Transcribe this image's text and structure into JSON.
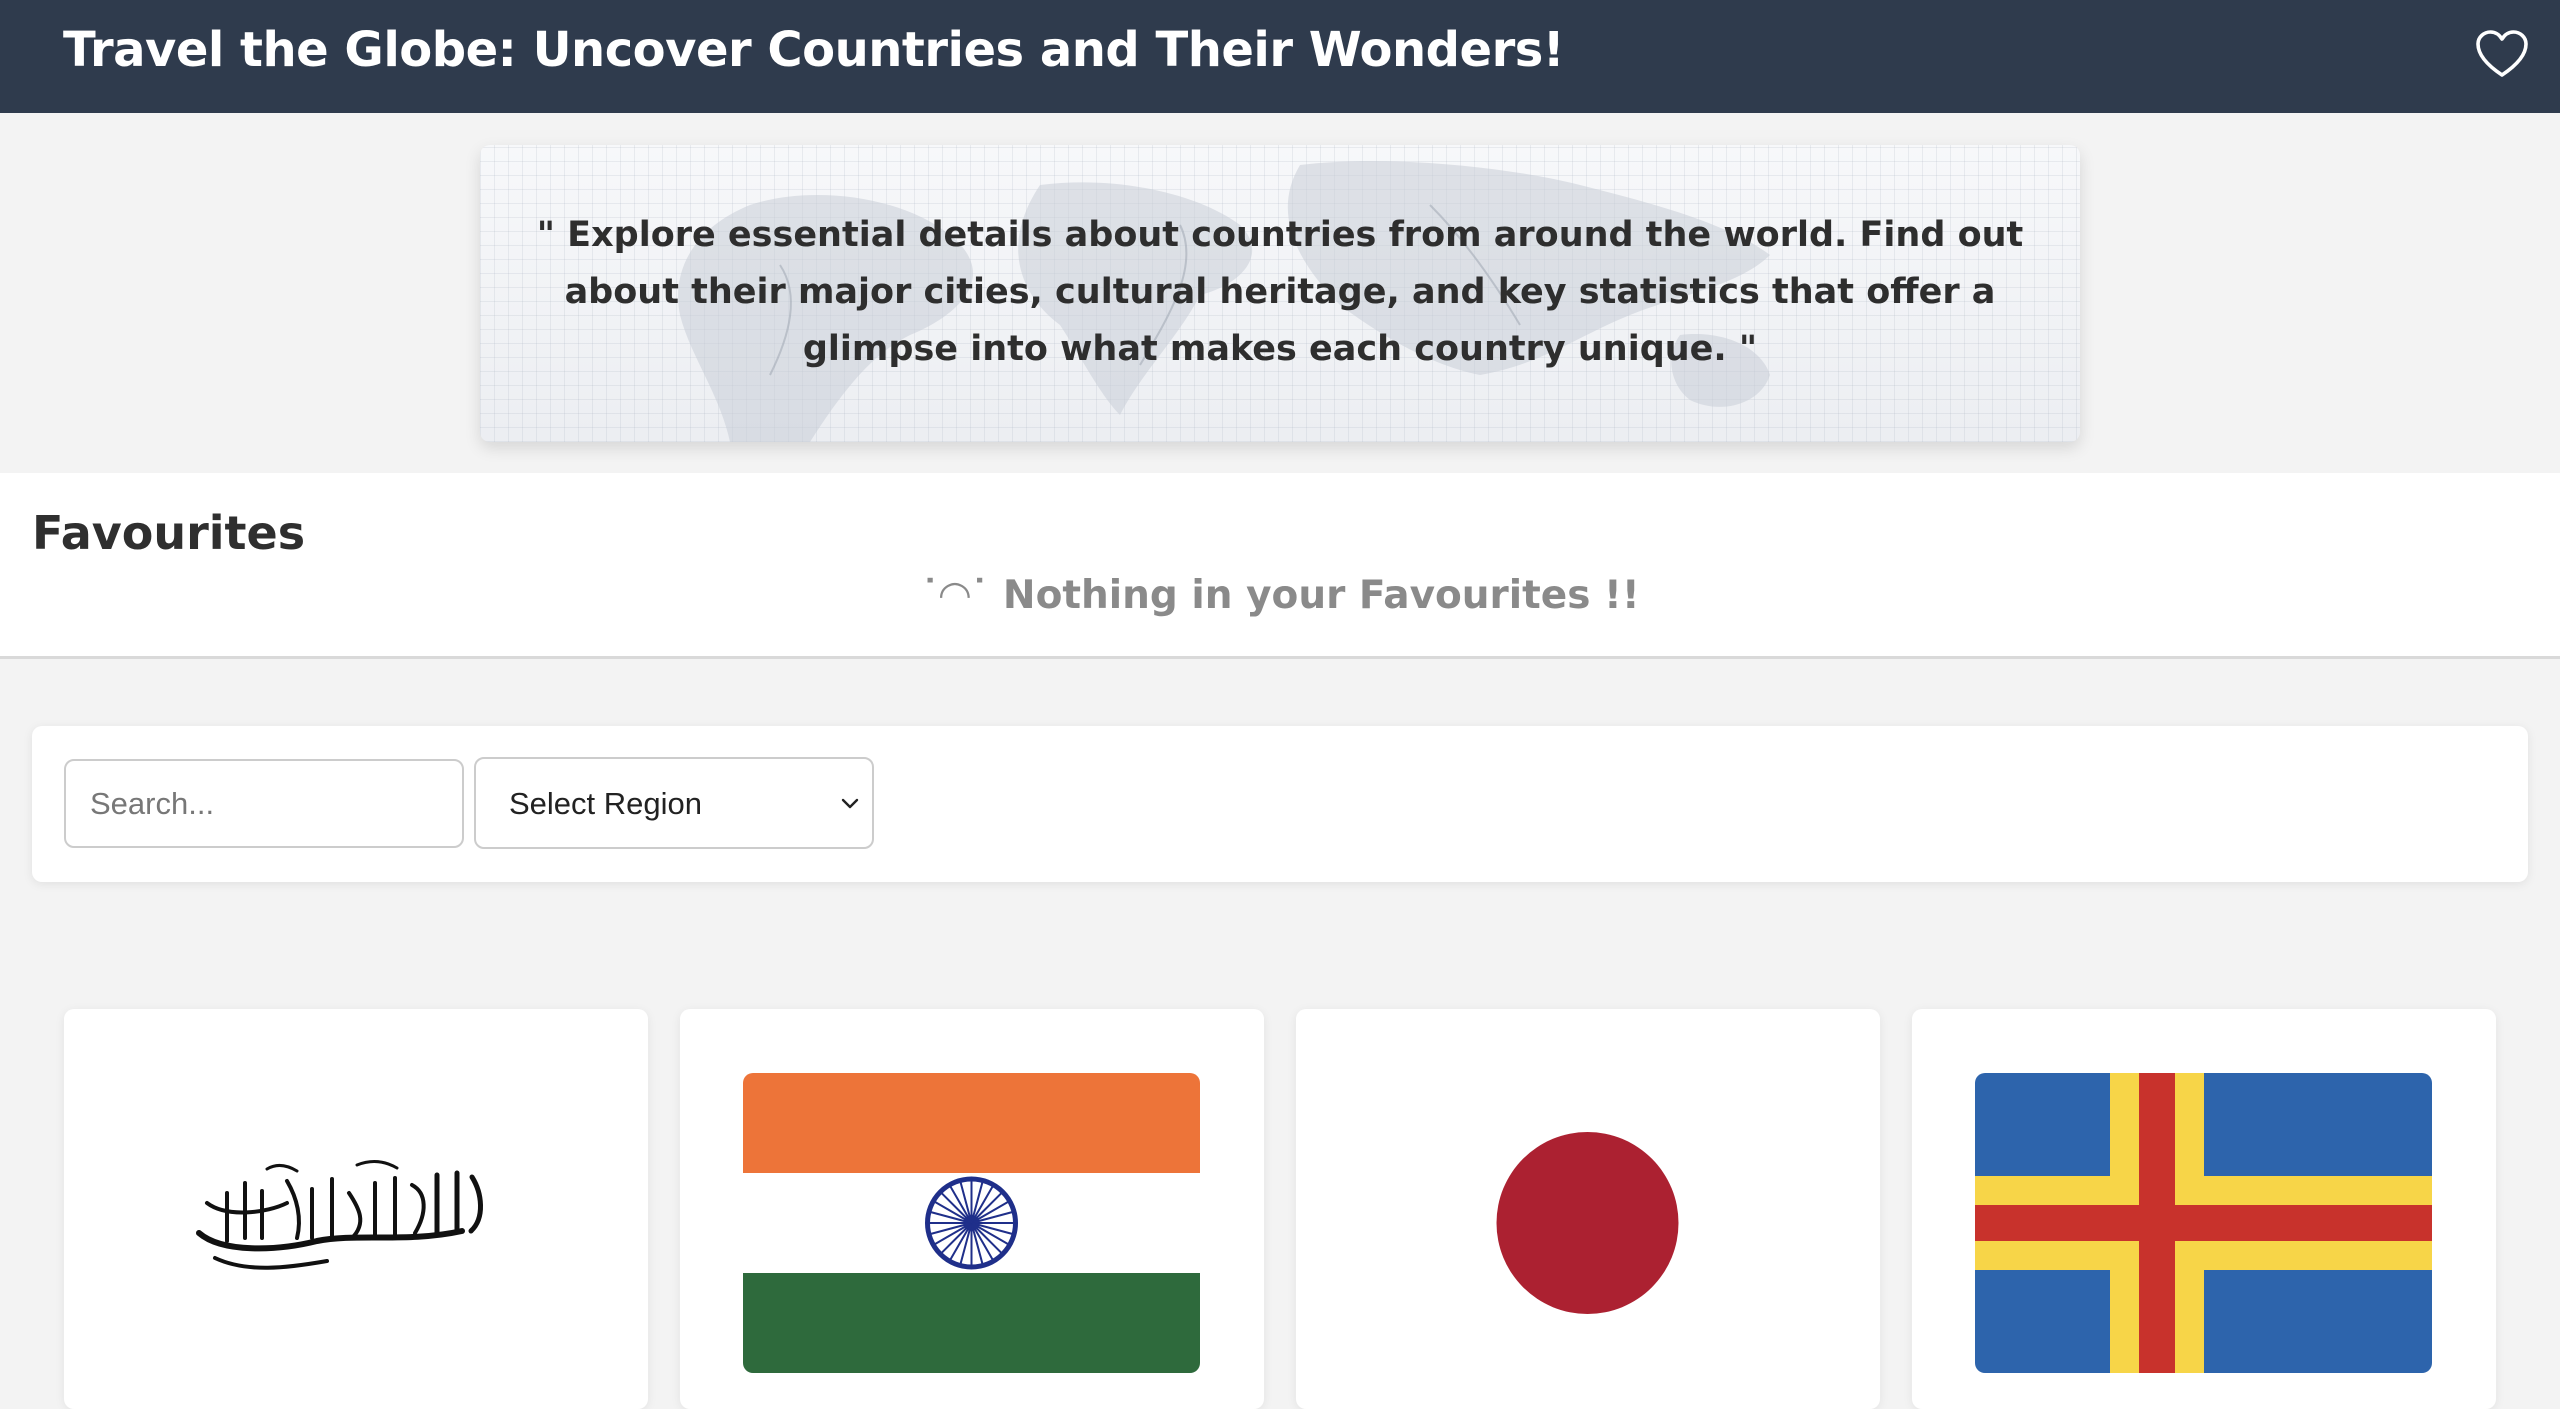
{
  "header": {
    "title": "Travel the Globe: Uncover Countries and Their Wonders!",
    "favourites_icon": "heart-outline-icon"
  },
  "hero": {
    "quote": "\" Explore essential details about countries from around the world. Find out about their major cities, cultural heritage, and key statistics that offer a glimpse into what makes each country unique. \""
  },
  "favourites": {
    "title": "Favourites",
    "empty_message": "˙◠˙ Nothing in your Favourites !!"
  },
  "filters": {
    "search_placeholder": "Search...",
    "region_selected": "Select Region",
    "region_icon": "chevron-down-icon"
  },
  "countries": [
    {
      "flag": "afghanistan-flag"
    },
    {
      "flag": "india-flag"
    },
    {
      "flag": "japan-flag"
    },
    {
      "flag": "aland-islands-flag"
    }
  ],
  "colors": {
    "header_bg": "#2f3b4d",
    "page_bg": "#f3f3f3",
    "india_saffron": "#ed7439",
    "india_green": "#2e6a3c",
    "india_chakra": "#1f2f8a",
    "japan_red": "#ac2131",
    "aland_blue": "#2d64ac",
    "aland_yellow": "#f7d548",
    "aland_red": "#c8322c"
  }
}
